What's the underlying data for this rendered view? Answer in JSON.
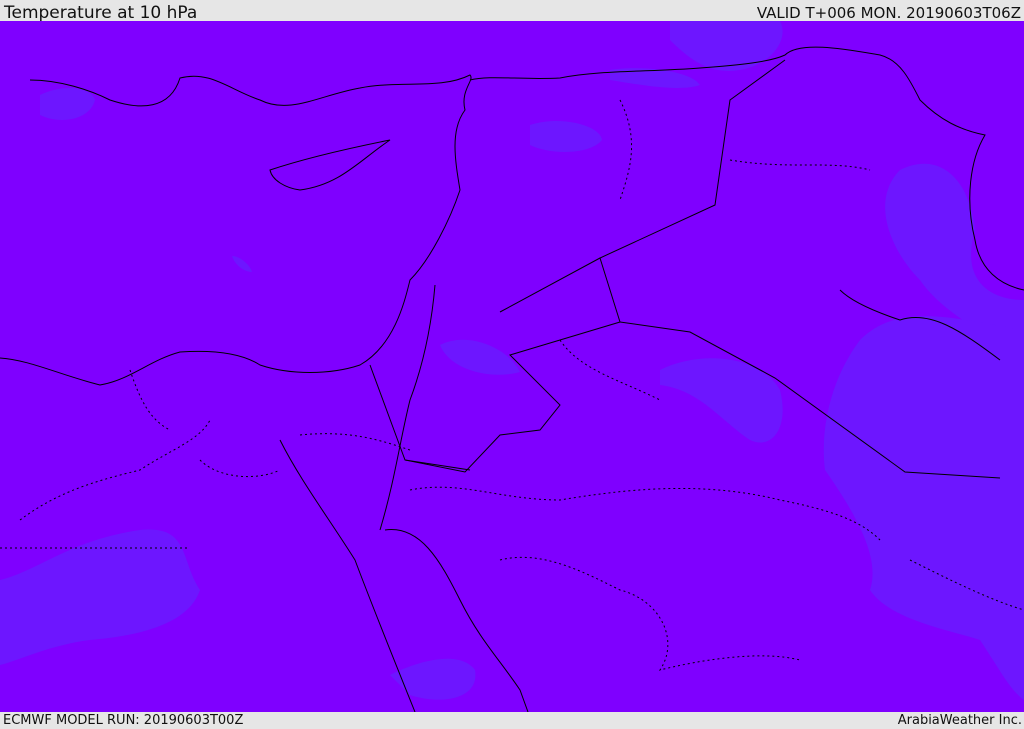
{
  "header": {
    "title": "Temperature at 10 hPa",
    "valid": "VALID T+006 MON. 20190603T06Z"
  },
  "footer": {
    "model_run": "ECMWF MODEL RUN: 20190603T00Z",
    "credit": "ArabiaWeather Inc."
  },
  "colors": {
    "field_base": "#7f00ff",
    "field_warmer": "#6a1aff",
    "coastline": "#000000"
  }
}
